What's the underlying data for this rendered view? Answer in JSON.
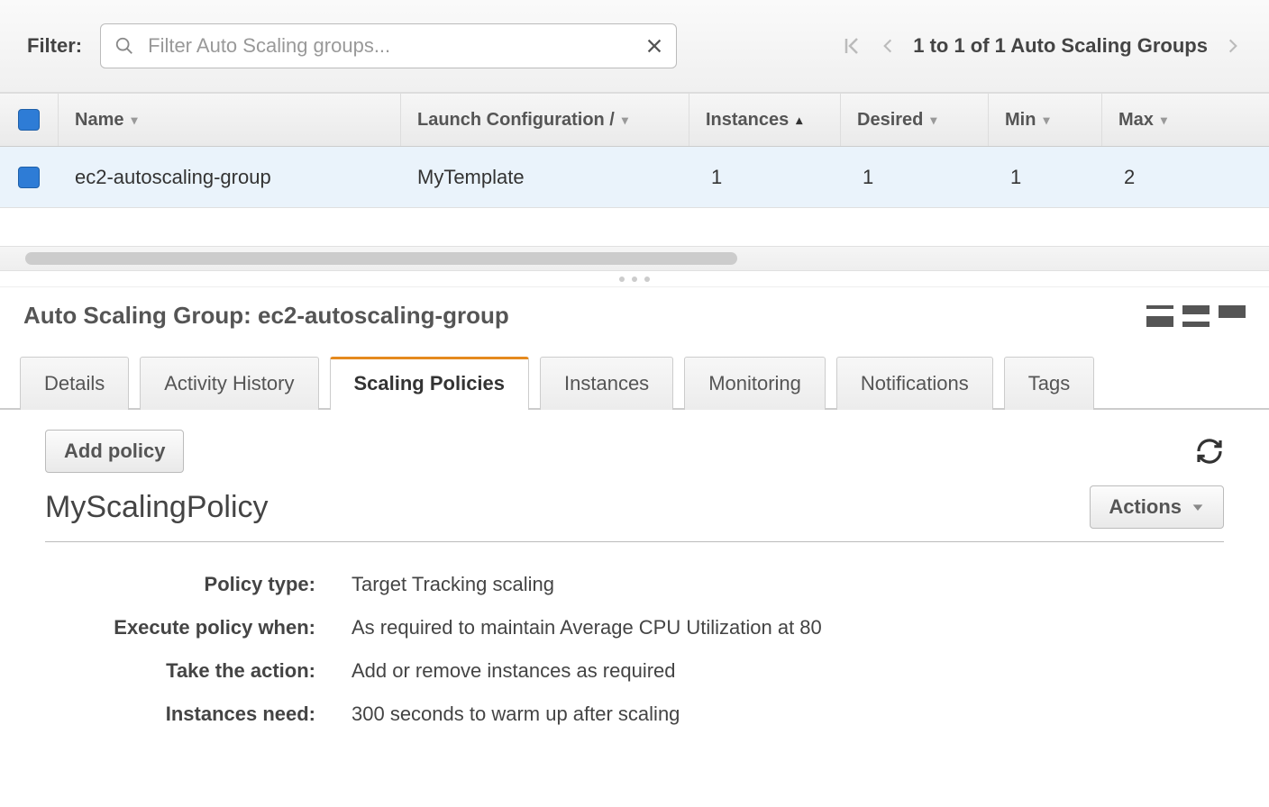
{
  "filter": {
    "label": "Filter:",
    "placeholder": "Filter Auto Scaling groups..."
  },
  "pager": {
    "text": "1 to 1 of 1 Auto Scaling Groups"
  },
  "table": {
    "columns": {
      "name": "Name",
      "launch": "Launch Configuration /",
      "instances": "Instances",
      "desired": "Desired",
      "min": "Min",
      "max": "Max"
    },
    "row": {
      "name": "ec2-autoscaling-group",
      "launch": "MyTemplate",
      "instances": "1",
      "desired": "1",
      "min": "1",
      "max": "2"
    }
  },
  "detail": {
    "title_prefix": "Auto Scaling Group: ",
    "title_name": "ec2-autoscaling-group"
  },
  "tabs": {
    "details": "Details",
    "activity": "Activity History",
    "scaling": "Scaling Policies",
    "instances": "Instances",
    "monitoring": "Monitoring",
    "notifications": "Notifications",
    "tags": "Tags"
  },
  "policy": {
    "add_button": "Add policy",
    "actions_button": "Actions",
    "name": "MyScalingPolicy",
    "fields": {
      "type_label": "Policy type:",
      "type_value": "Target Tracking scaling",
      "execute_label": "Execute policy when:",
      "execute_value": "As required to maintain Average CPU Utilization at 80",
      "action_label": "Take the action:",
      "action_value": "Add or remove instances as required",
      "warmup_label": "Instances need:",
      "warmup_value": "300 seconds to warm up after scaling"
    }
  }
}
